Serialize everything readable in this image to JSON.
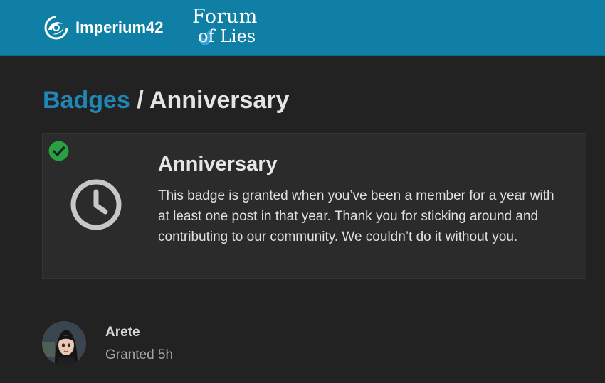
{
  "header": {
    "site_logo_text": "Imperium42",
    "forum_logo_line1": "Forum",
    "forum_logo_line2": "of Lies",
    "colors": {
      "header_bg": "#0f7fa5"
    }
  },
  "breadcrumb": {
    "parent": "Badges",
    "separator": "/",
    "current": "Anniversary"
  },
  "badge": {
    "title": "Anniversary",
    "description": "This badge is granted when you’ve been a member for a year with at least one post in that year. Thank you for sticking around and contributing to our community. We couldn’t do it without you.",
    "icon": "clock-icon",
    "granted_indicator_icon": "check-circle-icon",
    "colors": {
      "check": "#27a243",
      "icon": "#c7c7c7"
    }
  },
  "grantees": [
    {
      "name": "Arete",
      "granted": "Granted 5h"
    }
  ],
  "colors": {
    "page_bg": "#222222",
    "link": "#1f86b6"
  }
}
